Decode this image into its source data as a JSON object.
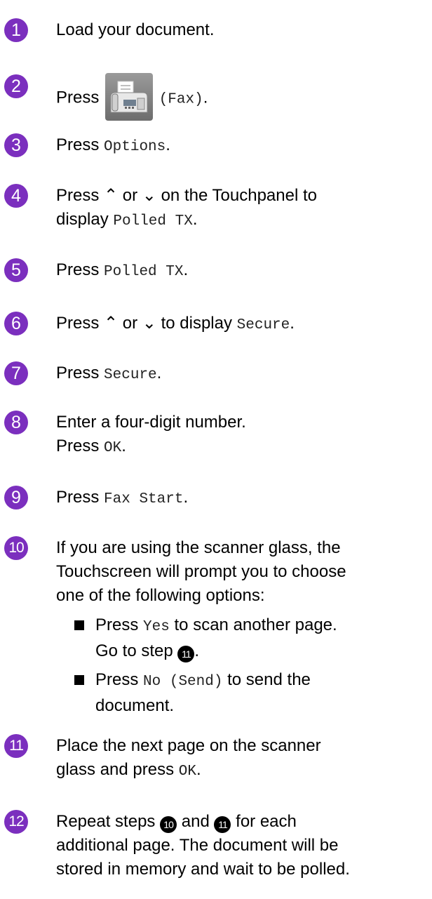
{
  "steps": [
    {
      "num": "1",
      "text": "Load your document."
    },
    {
      "num": "2",
      "pre": "Press",
      "code": "(Fax)",
      "post": ".",
      "icon": "fax-machine-icon"
    },
    {
      "num": "3",
      "pre": "Press",
      "code": "Options",
      "post": "."
    },
    {
      "num": "4",
      "line1": "Press ⌃ or ⌄ on the Touchpanel to",
      "line2_pre": "display",
      "line2_code": "Polled TX",
      "line2_post": "."
    },
    {
      "num": "5",
      "pre": "Press",
      "code": "Polled TX",
      "post": "."
    },
    {
      "num": "6",
      "pre": "Press ⌃ or ⌄ to display",
      "code": "Secure",
      "post": "."
    },
    {
      "num": "7",
      "pre": "Press",
      "code": "Secure",
      "post": "."
    },
    {
      "num": "8",
      "line1": "Enter a four-digit number.",
      "line2_pre": "Press",
      "line2_code": "OK",
      "line2_post": "."
    },
    {
      "num": "9",
      "pre": "Press",
      "code": "Fax Start",
      "post": "."
    },
    {
      "num": "10",
      "line1": "If you are using the scanner glass, the",
      "line2": "Touchscreen will prompt you to choose",
      "line3": "one of the following options:",
      "bullets": [
        {
          "pre": "Press",
          "code": "Yes",
          "post": "to scan another page.",
          "line2_pre": "Go to step",
          "ref": "11",
          "line2_post": "."
        },
        {
          "pre": "Press",
          "code": "No (Send)",
          "post": "to send the",
          "line2_pre": "document."
        }
      ]
    },
    {
      "num": "11",
      "line1": "Place the next page on the scanner",
      "line2_pre": "glass and press",
      "line2_code": "OK",
      "line2_post": "."
    },
    {
      "num": "12",
      "line1_pre": "Repeat steps",
      "ref_a": "10",
      "line1_mid": "and",
      "ref_b": "11",
      "line1_post": "for each",
      "line2": "additional page. The document will be",
      "line3": "stored in memory and wait to be polled."
    }
  ],
  "colors": {
    "badge": "#7b2fbe",
    "text": "#000000"
  }
}
